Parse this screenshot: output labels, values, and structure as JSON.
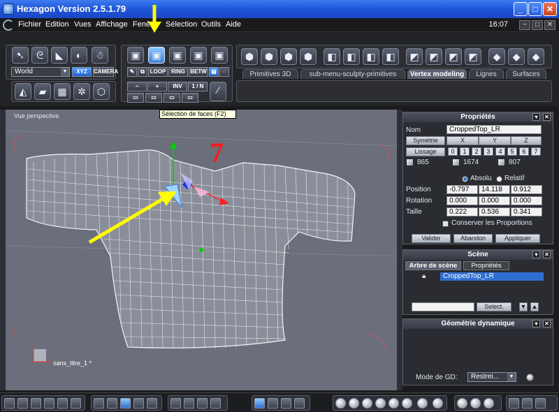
{
  "window": {
    "title": "Hexagon Version 2.5.1.79",
    "buttons": {
      "minimize": "_",
      "maximize": "□",
      "close": "✕"
    }
  },
  "menubar": {
    "items": [
      "Fichier",
      "Edition",
      "Vues",
      "Affichage",
      "Fenêtre",
      "Sélection",
      "Outils",
      "Aide"
    ],
    "clock": "16:07",
    "mini_buttons": [
      "−",
      "□",
      "✕"
    ]
  },
  "toolbar": {
    "coord_system": "World",
    "xyz_label": "XYZ",
    "camera_label": "CAMERA",
    "selection_buttons": [
      "LOOP",
      "RING",
      "BETW"
    ],
    "modifier_buttons": [
      "−",
      "+",
      "INV",
      "1 / N"
    ],
    "tooltip": "Sélection de faces (F2)",
    "tabs": [
      "Primitives 3D",
      "sub-menu-sculpty-primitives",
      "Vertex modeling",
      "Lignes",
      "Surfaces"
    ],
    "active_tab": "Vertex modeling"
  },
  "viewport": {
    "label": "Vue perspective",
    "doc_name": "sans_titre_1 *",
    "annotation_number": "7",
    "colors": {
      "background": "#6b6f7c",
      "annotation": "#ff1a1a",
      "arrow": "#ffff00"
    }
  },
  "properties": {
    "header": "Propriétés",
    "name_label": "Nom",
    "name_value": "CroppedTop_LR",
    "symmetry_label": "Symétrie",
    "axes": [
      "X",
      "Y",
      "Z"
    ],
    "smoothing_label": "Lissage",
    "smoothing_levels": [
      "0",
      "1",
      "2",
      "3",
      "4",
      "5",
      "6",
      "7"
    ],
    "counts": [
      "865",
      "1674",
      "807"
    ],
    "mode_absolute": "Absolu",
    "mode_relative": "Relatif",
    "rows": [
      {
        "label": "Position",
        "values": [
          "-0.797",
          "14.118",
          "0.912"
        ]
      },
      {
        "label": "Rotation",
        "values": [
          "0.000",
          "0.000",
          "0.000"
        ]
      },
      {
        "label": "Taille",
        "values": [
          "0.222",
          "0.536",
          "0.341"
        ]
      }
    ],
    "keep_proportions": "Conserver les Proportions",
    "buttons": [
      "Valider",
      "Abandon",
      "Appliquer"
    ]
  },
  "scene": {
    "header": "Scène",
    "tabs": [
      "Arbre de scène",
      "Propriétés"
    ],
    "items": [
      "CroppedTop_LR"
    ],
    "select_button": "Select."
  },
  "dynamic_geometry": {
    "header": "Géométrie dynamique",
    "mode_label": "Mode de GD:",
    "mode_value": "Restrei..."
  }
}
